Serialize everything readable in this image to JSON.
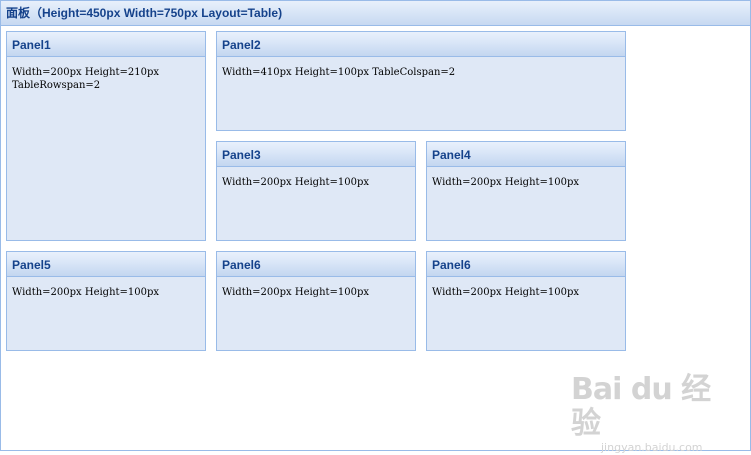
{
  "window": {
    "title": "面板（Height=450px Width=750px Layout=Table)"
  },
  "panels": [
    {
      "title": "Panel1",
      "body": "Width=200px Height=210px TableRowspan=2"
    },
    {
      "title": "Panel2",
      "body": "Width=410px Height=100px TableColspan=2"
    },
    {
      "title": "Panel3",
      "body": "Width=200px Height=100px"
    },
    {
      "title": "Panel4",
      "body": "Width=200px Height=100px"
    },
    {
      "title": "Panel5",
      "body": "Width=200px Height=100px"
    },
    {
      "title": "Panel6",
      "body": "Width=200px Height=100px"
    },
    {
      "title": "Panel6",
      "body": "Width=200px Height=100px"
    }
  ],
  "watermark": {
    "logo": "Bai du 经验",
    "url": "jingyan.baidu.com"
  },
  "colors": {
    "header_text": "#15428b",
    "border": "#99bbe8",
    "panel_bg": "#dfe8f6"
  }
}
